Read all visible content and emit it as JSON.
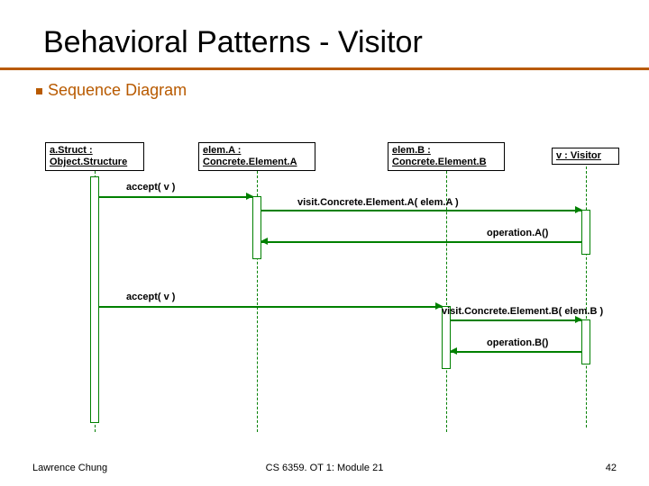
{
  "title": "Behavioral Patterns - Visitor",
  "subtitle": "Sequence Diagram",
  "lifelines": {
    "struct": {
      "line1": "a.Struct :",
      "line2": "Object.Structure"
    },
    "elemA": {
      "line1": "elem.A :",
      "line2": "Concrete.Element.A"
    },
    "elemB": {
      "line1": "elem.B :",
      "line2": "Concrete.Element.B"
    },
    "visitor": {
      "label": "v : Visitor"
    }
  },
  "messages": {
    "accept1": "accept( v )",
    "visitA": "visit.Concrete.Element.A( elem.A )",
    "opA": "operation.A()",
    "accept2": "accept( v )",
    "visitB": "visit.Concrete.Element.B( elem.B )",
    "opB": "operation.B()"
  },
  "footer": {
    "left": "Lawrence Chung",
    "center": "CS 6359. OT 1: Module 21",
    "right": "42"
  }
}
